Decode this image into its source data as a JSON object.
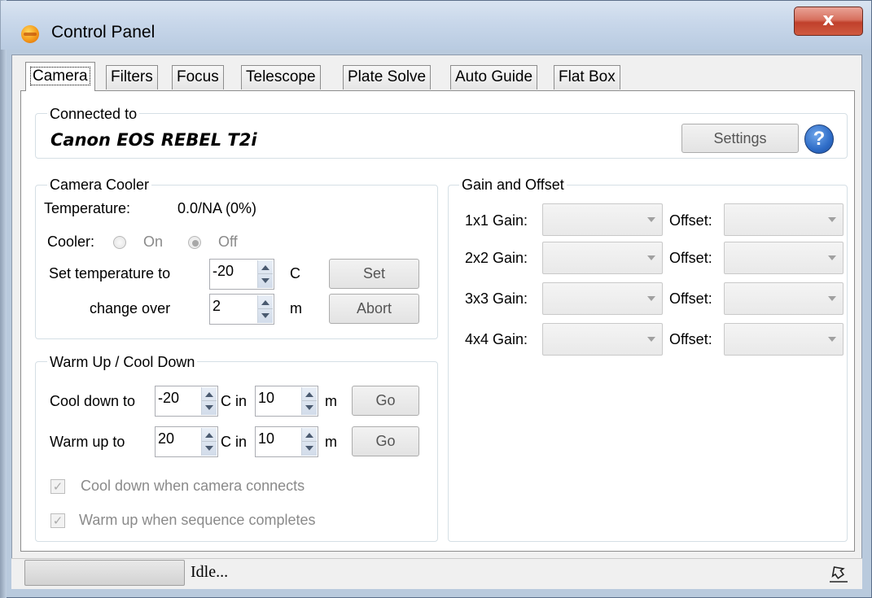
{
  "window": {
    "title": "Control Panel",
    "close_glyph": "x",
    "app_icon": "app-orange-icon"
  },
  "tabs": [
    {
      "label": "Camera",
      "active": true
    },
    {
      "label": "Filters"
    },
    {
      "label": "Focus"
    },
    {
      "label": "Telescope"
    },
    {
      "label": "Plate Solve"
    },
    {
      "label": "Auto Guide"
    },
    {
      "label": "Flat Box"
    }
  ],
  "connected": {
    "legend": "Connected to",
    "camera_name": "Canon EOS REBEL T2i",
    "settings_label": "Settings",
    "help_glyph": "?"
  },
  "cooler": {
    "legend": "Camera Cooler",
    "temperature_label": "Temperature:",
    "temperature_value": "0.0/NA (0%)",
    "cooler_label": "Cooler:",
    "on_label": "On",
    "off_label": "Off",
    "off_selected": true,
    "set_temp_label": "Set temperature to",
    "set_temp_value": "-20",
    "unit_c": "C",
    "set_button": "Set",
    "change_over_label": "change over",
    "change_over_value": "2",
    "unit_m": "m",
    "abort_button": "Abort"
  },
  "warm": {
    "legend": "Warm Up / Cool Down",
    "cool_down_label": "Cool down to",
    "cool_down_temp": "-20",
    "c_in_label": "C in",
    "cool_down_minutes": "10",
    "m_label": "m",
    "go_label": "Go",
    "warm_up_label": "Warm up to",
    "warm_up_temp": "20",
    "warm_up_minutes": "10",
    "cool_on_connect_label": "Cool down when camera connects",
    "warm_on_complete_label": "Warm up when sequence completes",
    "cool_on_connect_checked": true,
    "warm_on_complete_checked": true
  },
  "gain": {
    "legend": "Gain and Offset",
    "offset_label": "Offset:",
    "rows": [
      {
        "label": "1x1 Gain:",
        "gain": "",
        "offset": ""
      },
      {
        "label": "2x2 Gain:",
        "gain": "",
        "offset": ""
      },
      {
        "label": "3x3 Gain:",
        "gain": "",
        "offset": ""
      },
      {
        "label": "4x4 Gain:",
        "gain": "",
        "offset": ""
      }
    ]
  },
  "status": {
    "text": "Idle...",
    "progress": 0,
    "pin_icon": "pin-icon"
  },
  "colors": {
    "close_red": "#c0402b",
    "help_blue": "#2e6cc7",
    "frame": "#c4d3e5"
  }
}
